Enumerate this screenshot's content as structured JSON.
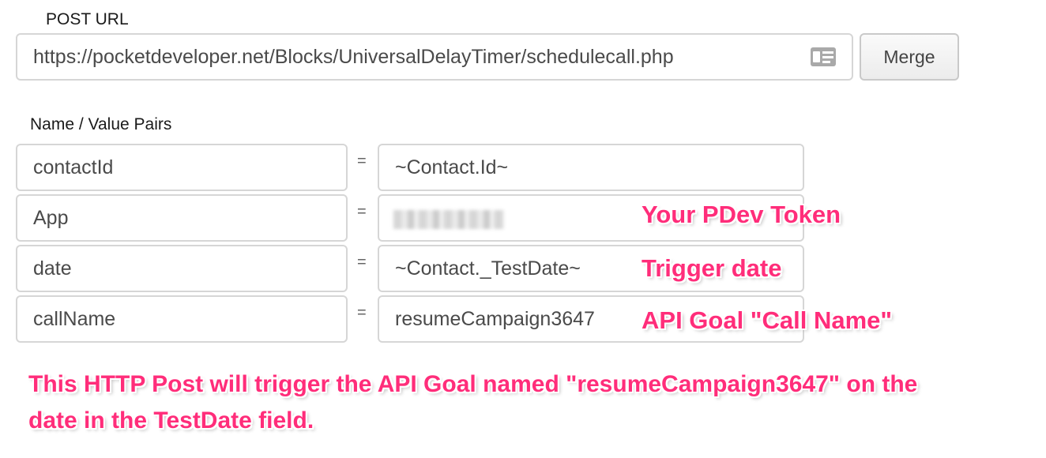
{
  "post_url": {
    "label": "POST URL",
    "value": "https://pocketdeveloper.net/Blocks/UniversalDelayTimer/schedulecall.php",
    "icon": "contact-card-icon",
    "merge_label": "Merge"
  },
  "pairs": {
    "label": "Name / Value Pairs",
    "equals": "=",
    "rows": [
      {
        "name": "contactId",
        "value": "~Contact.Id~"
      },
      {
        "name": "App",
        "value": ""
      },
      {
        "name": "date",
        "value": "~Contact._TestDate~"
      },
      {
        "name": "callName",
        "value": "resumeCampaign3647"
      }
    ]
  },
  "annotations": {
    "token": "Your PDev Token",
    "trigger_date": "Trigger date",
    "goal": "API Goal \"Call Name\"",
    "note_line1": "This HTTP Post will trigger the API Goal named \"resumeCampaign3647\" on the",
    "note_line2": "date in the TestDate field."
  },
  "colors": {
    "annotation": "#ff2d7a",
    "border": "#d6d6d6"
  }
}
